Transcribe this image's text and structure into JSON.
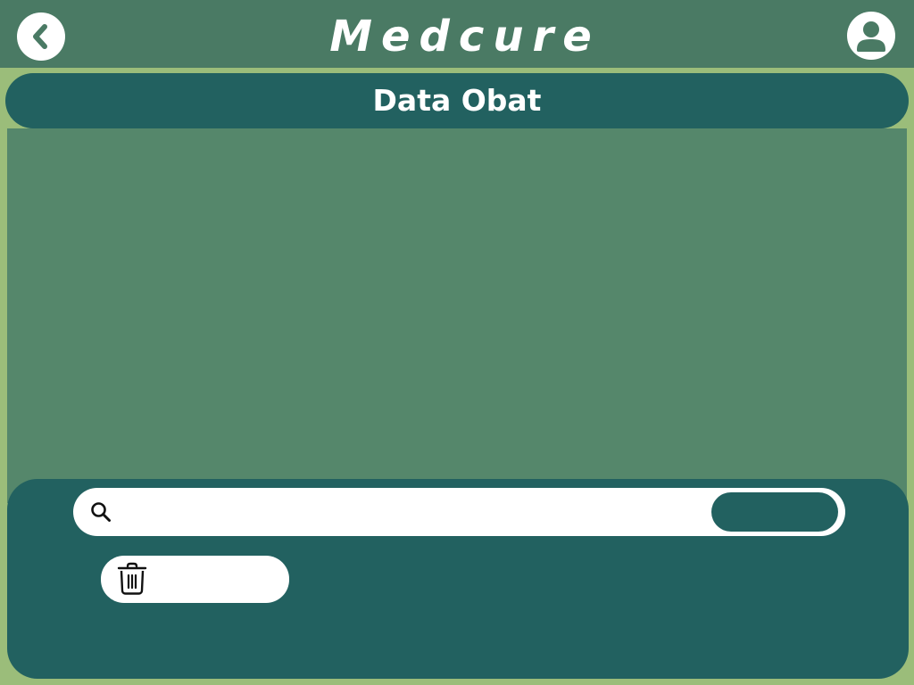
{
  "header": {
    "app_title": "Medcure",
    "back_icon": "chevron-left-icon",
    "profile_icon": "user-icon"
  },
  "section": {
    "title": "Data Obat"
  },
  "search": {
    "value": "",
    "placeholder": "",
    "icon": "search-icon",
    "button_label": ""
  },
  "actions": {
    "delete_label": "",
    "delete_icon": "trash-icon"
  },
  "colors": {
    "page_background": "#9bbd7a",
    "topbar": "#4a7a64",
    "content_area": "#55876b",
    "panel": "#226160",
    "surface": "#ffffff"
  }
}
